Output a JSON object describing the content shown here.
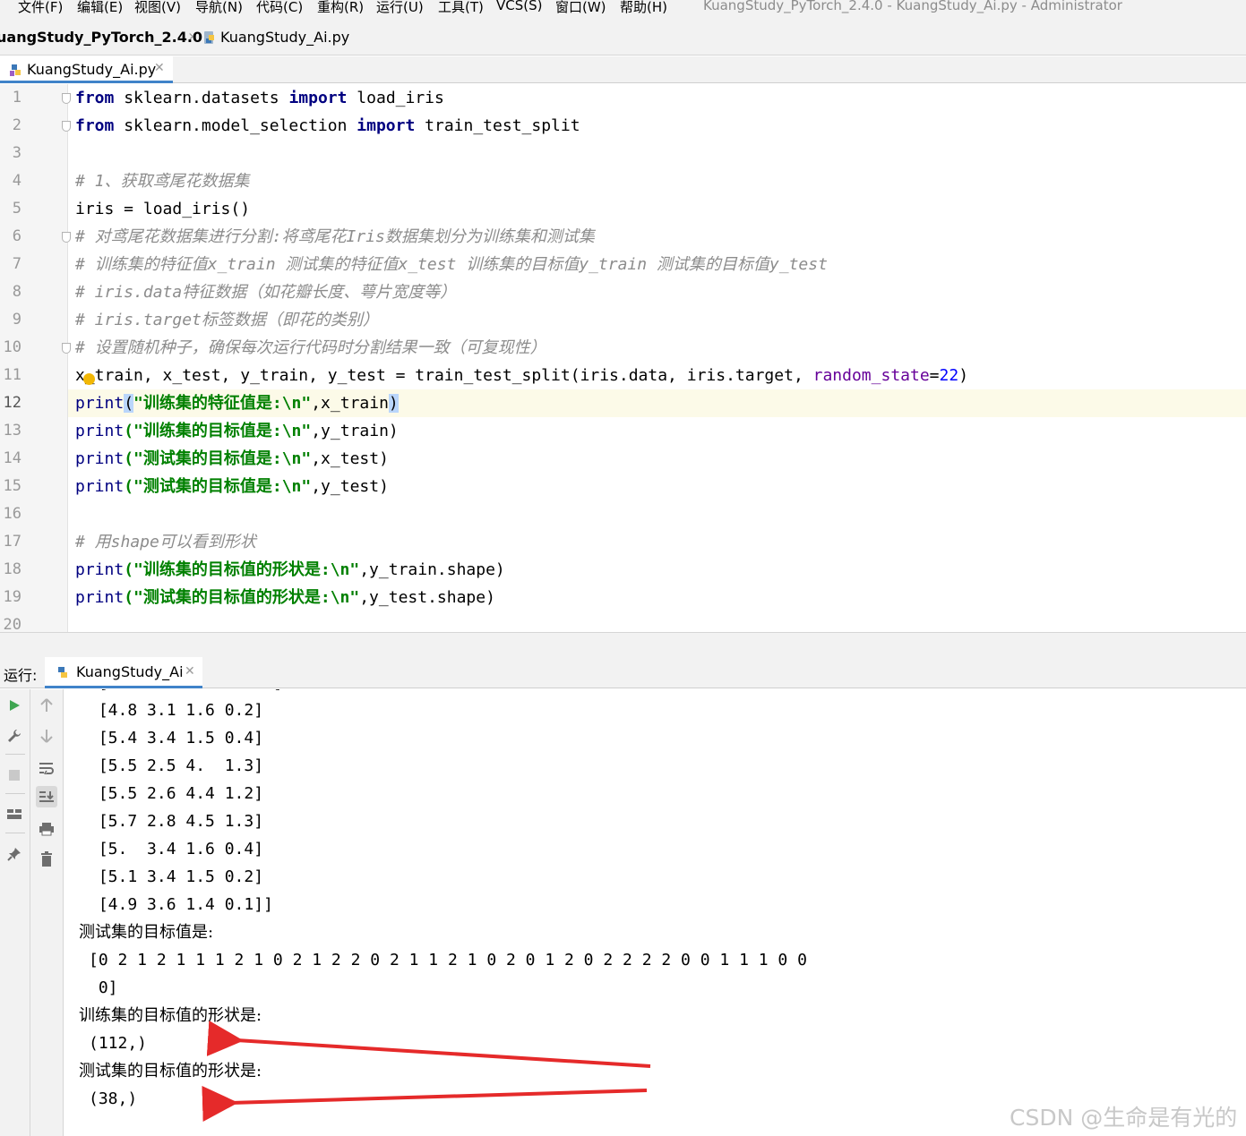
{
  "menu": {
    "items": [
      "文件(F)",
      "编辑(E)",
      "视图(V)",
      "导航(N)",
      "代码(C)",
      "重构(R)",
      "运行(U)",
      "工具(T)",
      "VCS(S)",
      "窗口(W)",
      "帮助(H)"
    ],
    "window_title": "KuangStudy_PyTorch_2.4.0 - KuangStudy_Ai.py - Administrator"
  },
  "navbar": {
    "project": "uangStudy_PyTorch_2.4.0",
    "file": "KuangStudy_Ai.py"
  },
  "editor": {
    "tab_label": "KuangStudy_Ai.py",
    "line_numbers": [
      "1",
      "2",
      "3",
      "4",
      "5",
      "6",
      "7",
      "8",
      "9",
      "10",
      "11",
      "12",
      "13",
      "14",
      "15",
      "16",
      "17",
      "18",
      "19",
      "20"
    ],
    "lines": {
      "l1": {
        "kw1": "from",
        "mod": " sklearn.datasets ",
        "kw2": "import",
        "name": " load_iris"
      },
      "l2": {
        "kw1": "from",
        "mod": " sklearn.model_selection ",
        "kw2": "import",
        "name": " train_test_split"
      },
      "l4": "# 1、获取鸢尾花数据集",
      "l5": "iris = load_iris()",
      "l6": "# 对鸢尾花数据集进行分割:将鸢尾花Iris数据集划分为训练集和测试集",
      "l7": "# 训练集的特征值x_train 测试集的特征值x_test 训练集的目标值y_train 测试集的目标值y_test",
      "l8": "# iris.data特征数据（如花瓣长度、萼片宽度等）",
      "l9": "# iris.target标签数据（即花的类别）",
      "l10": "# 设置随机种子，确保每次运行代码时分割结果一致（可复现性）",
      "l11": {
        "pre": "x",
        "rest": "_train, x_test, y_train, y_test = train_test_split(iris.data, iris.target, ",
        "param": "random_state",
        "eq": "=",
        "num": "22",
        "close": ")"
      },
      "l12": {
        "fn": "print",
        "open": "(",
        "str": "\"训练集的特征值是:\\n\"",
        "args": ",x_train",
        "close": ")"
      },
      "l13": {
        "fn": "print",
        "str": "(\"训练集的目标值是:\\n\"",
        "args": ",y_train)"
      },
      "l14": {
        "fn": "print",
        "str": "(\"测试集的目标值是:\\n\"",
        "args": ",x_test)"
      },
      "l15": {
        "fn": "print",
        "str": "(\"测试集的目标值是:\\n\"",
        "args": ",y_test)"
      },
      "l17": "# 用shape可以看到形状",
      "l18": {
        "fn": "print",
        "str": "(\"训练集的目标值的形状是:\\n\"",
        "args": ",y_train.shape)"
      },
      "l19": {
        "fn": "print",
        "str": "(\"测试集的目标值的形状是:\\n\"",
        "args": ",y_test.shape)"
      }
    }
  },
  "run": {
    "label": "运行:",
    "tab_label": "KuangStudy_Ai",
    "output": [
      " [4.8 3.1 1.6 0.2]",
      " [5.4 3.4 1.5 0.4]",
      " [5.5 2.5 4.  1.3]",
      " [5.5 2.6 4.4 1.2]",
      " [5.7 2.8 4.5 1.3]",
      " [5.  3.4 1.6 0.4]",
      " [5.1 3.4 1.5 0.2]",
      " [4.9 3.6 1.4 0.1]]",
      "测试集的目标值是:",
      "[0 2 1 2 1 1 1 2 1 0 2 1 2 2 0 2 1 1 2 1 0 2 0 1 2 0 2 2 2 2 0 0 1 1 1 0 0",
      " 0]",
      "训练集的目标值的形状是:",
      "(112,)",
      "测试集的目标值的形状是:",
      "(38,)"
    ]
  },
  "watermark": "CSDN @生命是有光的",
  "colors": {
    "keyword": "#000080",
    "comment": "#8c8c8c",
    "string": "#008000",
    "param": "#660099",
    "number": "#0000ff",
    "current_line": "#fcfae8",
    "annotation_arrow": "#e52a2a"
  }
}
